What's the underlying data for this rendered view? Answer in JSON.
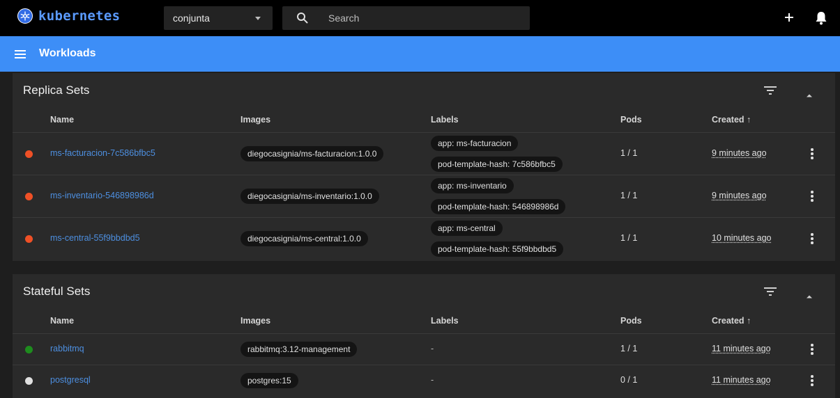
{
  "app": {
    "brand": "kubernetes"
  },
  "topbar": {
    "namespace": "conjunta",
    "search_placeholder": "Search"
  },
  "header": {
    "title": "Workloads"
  },
  "colors": {
    "accent": "#3d8ef7",
    "link": "#4d8fe0",
    "status_error": "#ef5026",
    "status_ok": "#1e8c1e",
    "status_pending": "#e0e0e0"
  },
  "replica_sets": {
    "title": "Replica Sets",
    "columns": {
      "name": "Name",
      "images": "Images",
      "labels": "Labels",
      "pods": "Pods",
      "created": "Created ↑"
    },
    "rows": [
      {
        "status": "error",
        "name": "ms-facturacion-7c586bfbc5",
        "image": "diegocasignia/ms-facturacion:1.0.0",
        "labels": [
          "app: ms-facturacion",
          "pod-template-hash: 7c586bfbc5"
        ],
        "pods": "1 / 1",
        "created": "9 minutes ago"
      },
      {
        "status": "error",
        "name": "ms-inventario-546898986d",
        "image": "diegocasignia/ms-inventario:1.0.0",
        "labels": [
          "app: ms-inventario",
          "pod-template-hash: 546898986d"
        ],
        "pods": "1 / 1",
        "created": "9 minutes ago"
      },
      {
        "status": "error",
        "name": "ms-central-55f9bbdbd5",
        "image": "diegocasignia/ms-central:1.0.0",
        "labels": [
          "app: ms-central",
          "pod-template-hash: 55f9bbdbd5"
        ],
        "pods": "1 / 1",
        "created": "10 minutes ago"
      }
    ]
  },
  "stateful_sets": {
    "title": "Stateful Sets",
    "columns": {
      "name": "Name",
      "images": "Images",
      "labels": "Labels",
      "pods": "Pods",
      "created": "Created ↑"
    },
    "rows": [
      {
        "status": "ok",
        "name": "rabbitmq",
        "image": "rabbitmq:3.12-management",
        "labels_text": "-",
        "pods": "1 / 1",
        "created": "11 minutes ago"
      },
      {
        "status": "pending",
        "name": "postgresql",
        "image": "postgres:15",
        "labels_text": "-",
        "pods": "0 / 1",
        "created": "11 minutes ago"
      }
    ]
  }
}
